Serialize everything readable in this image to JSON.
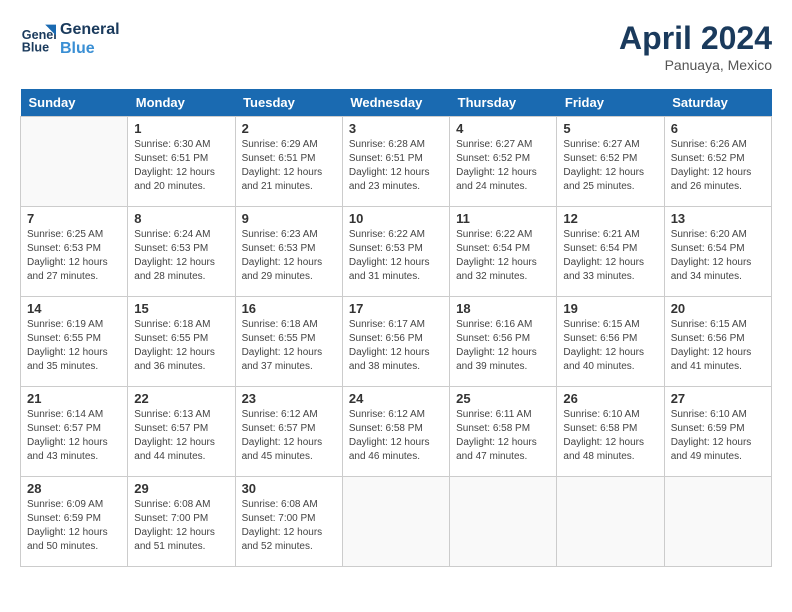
{
  "header": {
    "logo_line1": "General",
    "logo_line2": "Blue",
    "month_year": "April 2024",
    "location": "Panuaya, Mexico"
  },
  "weekdays": [
    "Sunday",
    "Monday",
    "Tuesday",
    "Wednesday",
    "Thursday",
    "Friday",
    "Saturday"
  ],
  "weeks": [
    [
      {
        "day": "",
        "empty": true
      },
      {
        "day": "1",
        "sunrise": "6:30 AM",
        "sunset": "6:51 PM",
        "daylight": "12 hours and 20 minutes."
      },
      {
        "day": "2",
        "sunrise": "6:29 AM",
        "sunset": "6:51 PM",
        "daylight": "12 hours and 21 minutes."
      },
      {
        "day": "3",
        "sunrise": "6:28 AM",
        "sunset": "6:51 PM",
        "daylight": "12 hours and 23 minutes."
      },
      {
        "day": "4",
        "sunrise": "6:27 AM",
        "sunset": "6:52 PM",
        "daylight": "12 hours and 24 minutes."
      },
      {
        "day": "5",
        "sunrise": "6:27 AM",
        "sunset": "6:52 PM",
        "daylight": "12 hours and 25 minutes."
      },
      {
        "day": "6",
        "sunrise": "6:26 AM",
        "sunset": "6:52 PM",
        "daylight": "12 hours and 26 minutes."
      }
    ],
    [
      {
        "day": "7",
        "sunrise": "6:25 AM",
        "sunset": "6:53 PM",
        "daylight": "12 hours and 27 minutes."
      },
      {
        "day": "8",
        "sunrise": "6:24 AM",
        "sunset": "6:53 PM",
        "daylight": "12 hours and 28 minutes."
      },
      {
        "day": "9",
        "sunrise": "6:23 AM",
        "sunset": "6:53 PM",
        "daylight": "12 hours and 29 minutes."
      },
      {
        "day": "10",
        "sunrise": "6:22 AM",
        "sunset": "6:53 PM",
        "daylight": "12 hours and 31 minutes."
      },
      {
        "day": "11",
        "sunrise": "6:22 AM",
        "sunset": "6:54 PM",
        "daylight": "12 hours and 32 minutes."
      },
      {
        "day": "12",
        "sunrise": "6:21 AM",
        "sunset": "6:54 PM",
        "daylight": "12 hours and 33 minutes."
      },
      {
        "day": "13",
        "sunrise": "6:20 AM",
        "sunset": "6:54 PM",
        "daylight": "12 hours and 34 minutes."
      }
    ],
    [
      {
        "day": "14",
        "sunrise": "6:19 AM",
        "sunset": "6:55 PM",
        "daylight": "12 hours and 35 minutes."
      },
      {
        "day": "15",
        "sunrise": "6:18 AM",
        "sunset": "6:55 PM",
        "daylight": "12 hours and 36 minutes."
      },
      {
        "day": "16",
        "sunrise": "6:18 AM",
        "sunset": "6:55 PM",
        "daylight": "12 hours and 37 minutes."
      },
      {
        "day": "17",
        "sunrise": "6:17 AM",
        "sunset": "6:56 PM",
        "daylight": "12 hours and 38 minutes."
      },
      {
        "day": "18",
        "sunrise": "6:16 AM",
        "sunset": "6:56 PM",
        "daylight": "12 hours and 39 minutes."
      },
      {
        "day": "19",
        "sunrise": "6:15 AM",
        "sunset": "6:56 PM",
        "daylight": "12 hours and 40 minutes."
      },
      {
        "day": "20",
        "sunrise": "6:15 AM",
        "sunset": "6:56 PM",
        "daylight": "12 hours and 41 minutes."
      }
    ],
    [
      {
        "day": "21",
        "sunrise": "6:14 AM",
        "sunset": "6:57 PM",
        "daylight": "12 hours and 43 minutes."
      },
      {
        "day": "22",
        "sunrise": "6:13 AM",
        "sunset": "6:57 PM",
        "daylight": "12 hours and 44 minutes."
      },
      {
        "day": "23",
        "sunrise": "6:12 AM",
        "sunset": "6:57 PM",
        "daylight": "12 hours and 45 minutes."
      },
      {
        "day": "24",
        "sunrise": "6:12 AM",
        "sunset": "6:58 PM",
        "daylight": "12 hours and 46 minutes."
      },
      {
        "day": "25",
        "sunrise": "6:11 AM",
        "sunset": "6:58 PM",
        "daylight": "12 hours and 47 minutes."
      },
      {
        "day": "26",
        "sunrise": "6:10 AM",
        "sunset": "6:58 PM",
        "daylight": "12 hours and 48 minutes."
      },
      {
        "day": "27",
        "sunrise": "6:10 AM",
        "sunset": "6:59 PM",
        "daylight": "12 hours and 49 minutes."
      }
    ],
    [
      {
        "day": "28",
        "sunrise": "6:09 AM",
        "sunset": "6:59 PM",
        "daylight": "12 hours and 50 minutes."
      },
      {
        "day": "29",
        "sunrise": "6:08 AM",
        "sunset": "7:00 PM",
        "daylight": "12 hours and 51 minutes."
      },
      {
        "day": "30",
        "sunrise": "6:08 AM",
        "sunset": "7:00 PM",
        "daylight": "12 hours and 52 minutes."
      },
      {
        "day": "",
        "empty": true
      },
      {
        "day": "",
        "empty": true
      },
      {
        "day": "",
        "empty": true
      },
      {
        "day": "",
        "empty": true
      }
    ]
  ],
  "labels": {
    "sunrise_prefix": "Sunrise: ",
    "sunset_prefix": "Sunset: ",
    "daylight_prefix": "Daylight: "
  }
}
